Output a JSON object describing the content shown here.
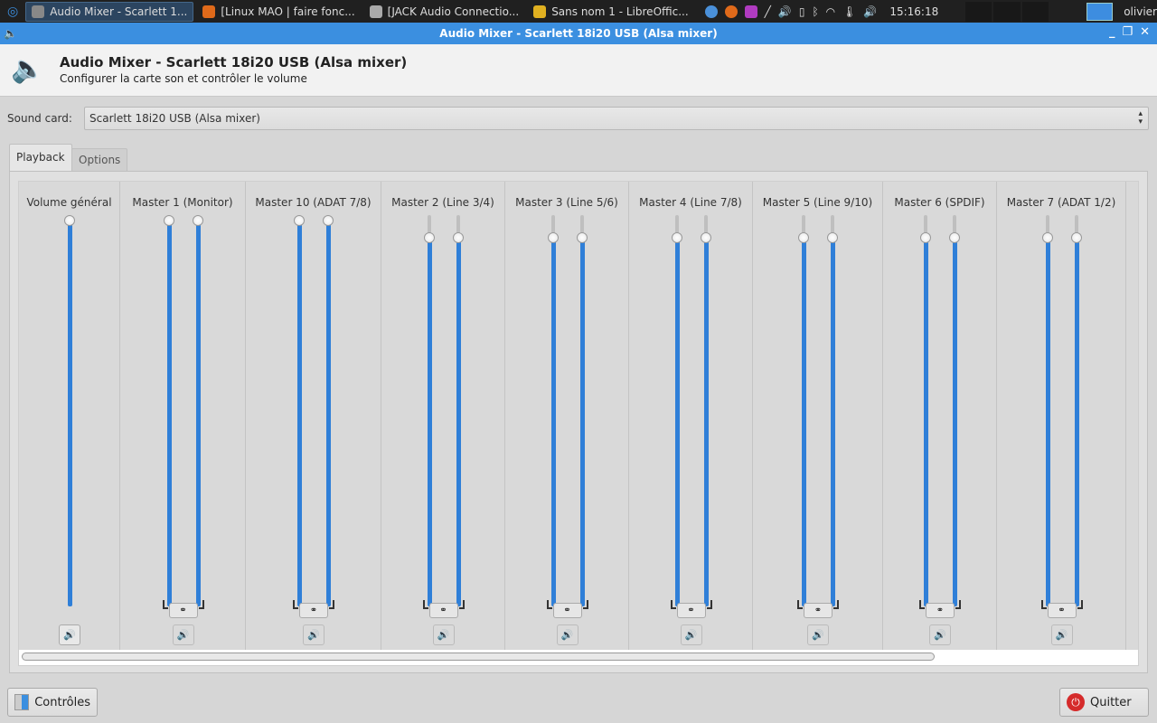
{
  "taskbar": {
    "tasks": [
      {
        "label": "Audio Mixer - Scarlett 1...",
        "active": true
      },
      {
        "label": "[Linux MAO | faire fonc...",
        "active": false
      },
      {
        "label": "[JACK Audio Connectio...",
        "active": false
      },
      {
        "label": "Sans nom 1 - LibreOffic...",
        "active": false
      }
    ],
    "clock": "15:16:18",
    "user": "olivier"
  },
  "window": {
    "title": "Audio Mixer - Scarlett 18i20 USB (Alsa mixer)"
  },
  "header": {
    "title": "Audio Mixer - Scarlett 18i20 USB (Alsa mixer)",
    "subtitle": "Configurer la carte son et contrôler le volume"
  },
  "sound_card": {
    "label": "Sound card:",
    "value": "Scarlett 18i20 USB (Alsa mixer)"
  },
  "tabs": [
    {
      "label": "Playback",
      "active": true
    },
    {
      "label": "Options",
      "active": false
    }
  ],
  "channels": [
    {
      "name": "Volume général",
      "stereo": false,
      "levels": [
        1.0
      ],
      "mute_enabled": true
    },
    {
      "name": "Master 1 (Monitor)",
      "stereo": true,
      "levels": [
        1.0,
        1.0
      ],
      "mute_enabled": false
    },
    {
      "name": "Master 10 (ADAT 7/8)",
      "stereo": true,
      "levels": [
        1.0,
        1.0
      ],
      "mute_enabled": false
    },
    {
      "name": "Master 2 (Line 3/4)",
      "stereo": true,
      "levels": [
        0.955,
        0.955
      ],
      "mute_enabled": false
    },
    {
      "name": "Master 3 (Line 5/6)",
      "stereo": true,
      "levels": [
        0.955,
        0.955
      ],
      "mute_enabled": false
    },
    {
      "name": "Master 4 (Line 7/8)",
      "stereo": true,
      "levels": [
        0.955,
        0.955
      ],
      "mute_enabled": false
    },
    {
      "name": "Master 5 (Line 9/10)",
      "stereo": true,
      "levels": [
        0.955,
        0.955
      ],
      "mute_enabled": false
    },
    {
      "name": "Master 6 (SPDIF)",
      "stereo": true,
      "levels": [
        0.955,
        0.955
      ],
      "mute_enabled": false
    },
    {
      "name": "Master 7 (ADAT 1/2)",
      "stereo": true,
      "levels": [
        0.955,
        0.955
      ],
      "mute_enabled": false
    }
  ],
  "buttons": {
    "controls": "Contrôles",
    "quit": "Quitter"
  },
  "colors": {
    "accent": "#3b8fe0",
    "slider_fill": "#2f7fd8"
  }
}
